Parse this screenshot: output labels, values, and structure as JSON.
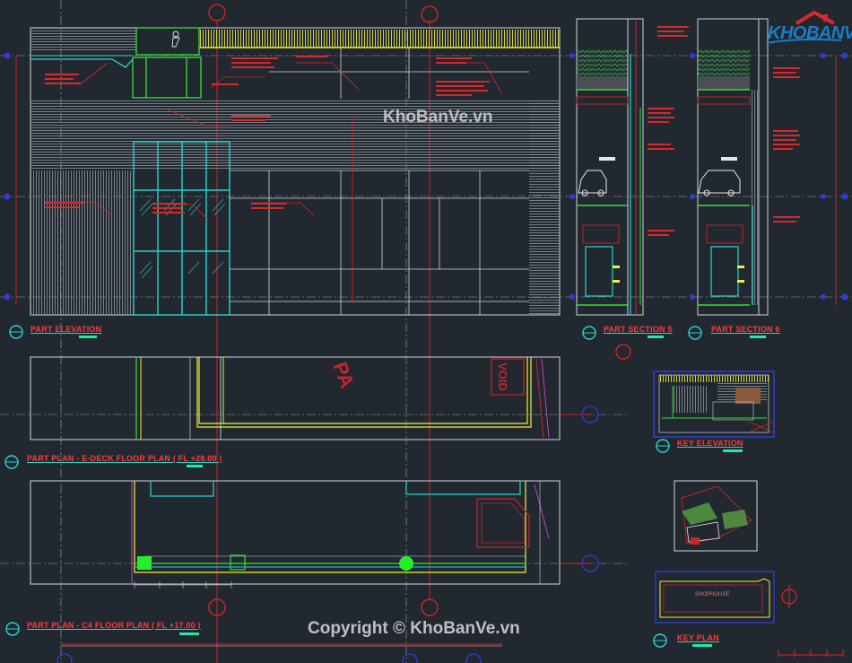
{
  "watermarks": {
    "center": "KhoBanVe.vn",
    "footer": "Copyright © KhoBanVe.vn"
  },
  "logo": {
    "text": "KHOBANVE",
    "brand_color": "#1b7cc4"
  },
  "titles": {
    "part_elevation": "PART ELEVATION",
    "part_section_5": "PART SECTION 5",
    "part_section_6": "PART SECTION 6",
    "plan_edeck": "PART PLAN - E-DECK FLOOR PLAN ( FL +28.00 )",
    "key_elevation": "KEY ELEVATION",
    "plan_c4": "PART PLAN - C4 FLOOR PLAN ( FL +17.00 )",
    "key_plan": "KEY PLAN"
  },
  "plan_marks": {
    "pa": "PA",
    "void": "VOID",
    "shophouse": "SHOPHOUSE"
  },
  "colors": {
    "background": "#212830",
    "frame": "#cfd6dc",
    "grid_red": "#e02424",
    "cyan": "#27d6d0",
    "yellow": "#f0f03a",
    "green": "#36e03a",
    "hatch": "#8f979e",
    "blue": "#2d3ed0"
  }
}
